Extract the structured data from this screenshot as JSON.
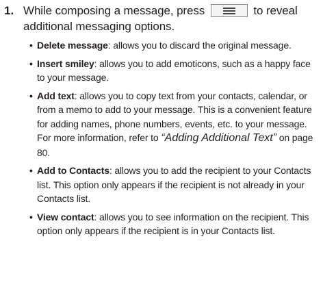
{
  "step": {
    "number": "1.",
    "text_before": "While composing a message, press",
    "key_icon": "menu-key-icon",
    "text_after": "to reveal additional messaging options."
  },
  "options": [
    {
      "term": "Delete message",
      "text": ": allows you to discard the original message."
    },
    {
      "term": "Insert smiley",
      "text": ": allows you to add emoticons, such as a happy face to your message."
    },
    {
      "term": "Add text",
      "text": ": allows you to copy text from your contacts, calendar, or from a memo to add to your message. This is a convenient feature for adding names, phone numbers, events, etc. to your message. For more information, refer to ",
      "xref": "“Adding Additional Text”",
      "text_end": " on page 80."
    },
    {
      "term": "Add to Contacts",
      "text": ": allows you to add the recipient to your Contacts list. This option only appears if the recipient is not already in your Contacts list."
    },
    {
      "term": "View contact",
      "text": ": allows you to see information on the recipient. This option only appears if the recipient is in your Contacts list."
    }
  ],
  "bullet_char": "•"
}
